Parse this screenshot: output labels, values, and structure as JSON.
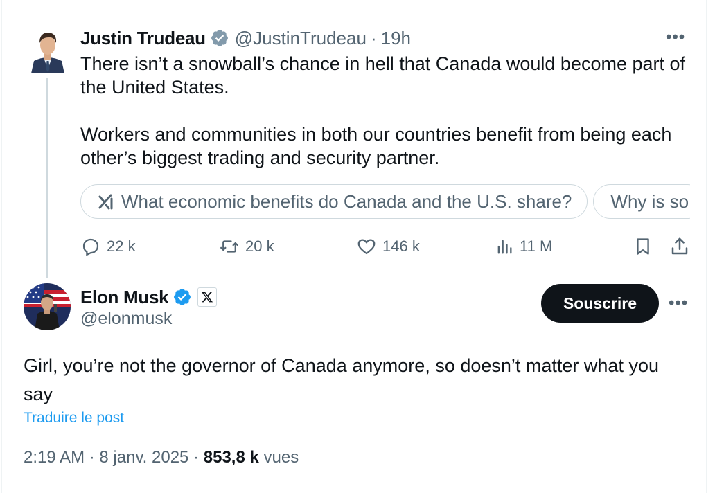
{
  "parent_tweet": {
    "author_name": "Justin Trudeau",
    "handle": "@JustinTrudeau",
    "separator": "·",
    "time": "19h",
    "text": "There isn’t a snowball’s chance in hell that Canada would become part of the United States.\n\nWorkers and communities in both our countries benefit from being each other’s biggest trading and security partner.",
    "grok_suggestions": [
      "What economic benefits do Canada and the U.S. share?",
      "Why is so"
    ],
    "replies": "22 k",
    "reposts": "20 k",
    "likes": "146 k",
    "views": "11 M",
    "more_label": "•••"
  },
  "reply_tweet": {
    "author_name": "Elon Musk",
    "handle": "@elonmusk",
    "subscribe_label": "Souscrire",
    "more_label": "•••",
    "text": "Girl, you’re not the governor of Canada anymore, so doesn’t matter what you say",
    "translate_label": "Traduire le post",
    "time": "2:19 AM",
    "date": "8 janv. 2025",
    "separator": "·",
    "views_count": "853,8 k",
    "views_label": "vues"
  },
  "colors": {
    "text_primary": "#0f1419",
    "text_secondary": "#536471",
    "link_blue": "#1d9bf0",
    "verified_blue": "#1d9bf0",
    "verified_gray": "#829aab",
    "button_dark": "#0f1419",
    "border": "#cfd9de"
  },
  "icons": {
    "verified_government": "verified-gray-icon",
    "verified_blue": "verified-blue-icon",
    "affiliate": "x-logo-icon",
    "grok": "grok-icon",
    "reply": "reply-icon",
    "repost": "repost-icon",
    "like": "heart-icon",
    "views": "analytics-icon",
    "bookmark": "bookmark-icon",
    "share": "share-icon"
  }
}
